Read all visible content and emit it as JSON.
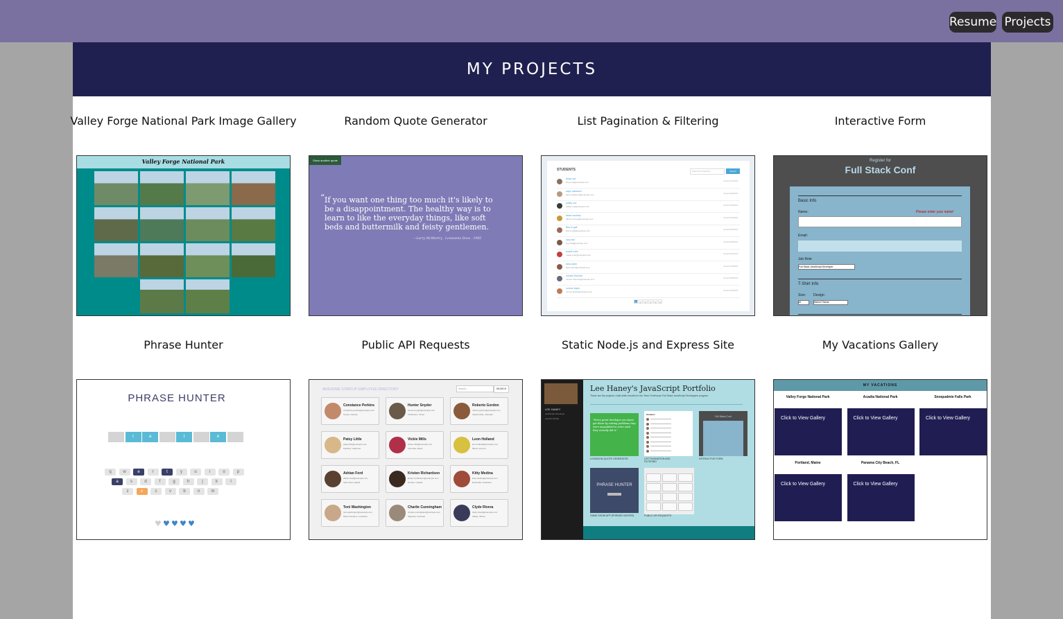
{
  "nav": {
    "resume": "Resume",
    "projects": "Projects"
  },
  "banner": {
    "title": "MY PROJECTS"
  },
  "projects": [
    {
      "title": "Valley Forge National Park Image Gallery"
    },
    {
      "title": "Random Quote Generator"
    },
    {
      "title": "List Pagination & Filtering"
    },
    {
      "title": "Interactive Form"
    },
    {
      "title": "Phrase Hunter"
    },
    {
      "title": "Public API Requests"
    },
    {
      "title": "Static Node.js and Express Site"
    },
    {
      "title": "My Vacations Gallery"
    }
  ],
  "thumb_gallery": {
    "heading": "Valley Forge National Park"
  },
  "thumb_quote": {
    "button": "Show another quote",
    "quote": "If you want one thing too much it's likely to be a disappointment. The healthy way is to learn to like the everyday things, like soft beds and buttermilk and feisty gentlemen.",
    "citation": "—Larry McMurtry , Lonesome Dove , 1985"
  },
  "thumb_students": {
    "heading": "STUDENTS",
    "search_placeholder": "Search for students...",
    "search_button": "Search",
    "rows": [
      {
        "name": "iboya vat",
        "email": "iboya.vat@example.com",
        "joined": "Joined 07/15/15"
      },
      {
        "name": "aapo niskanen",
        "email": "aapo.niskanen@example.com",
        "joined": "Joined 06/15/15"
      },
      {
        "name": "phillip cox",
        "email": "phillip.cox@example.com",
        "joined": "Joined 03/02/15"
      },
      {
        "name": "ethan moreau",
        "email": "ethan.moreau@example.com",
        "joined": "Joined 07/03/15"
      },
      {
        "name": "lilou le gall",
        "email": "lilou.le gall@example.com",
        "joined": "Joined 09/10/15"
      },
      {
        "name": "lucy hall",
        "email": "lucy.hall@example.com",
        "joined": "Joined 08/20/15"
      },
      {
        "name": "maele colin",
        "email": "maele.colin@example.com",
        "joined": "Joined 05/14/15"
      },
      {
        "name": "kara owen",
        "email": "kara.owen@example.com",
        "joined": "Joined 07/02/15"
      },
      {
        "name": "romain francois",
        "email": "romain.francois@example.com",
        "joined": "Joined 08/16/15"
      },
      {
        "name": "connor taylor",
        "email": "connor.taylor@example.com",
        "joined": "Joined 09/15/15"
      }
    ],
    "pages": [
      "1",
      "2",
      "3",
      "4",
      "5",
      "6"
    ]
  },
  "thumb_form": {
    "register": "Register for",
    "conf": "Full Stack Conf",
    "basic_info": "Basic Info",
    "name_label": "Name:",
    "name_error": "Please enter your name!",
    "email_label": "Email:",
    "job_label": "Job Role",
    "job_value": "Full Stack JavaScript Developer",
    "tshirt": "T-Shirt Info",
    "size_label": "Size:",
    "size_value": "M",
    "design_label": "Design:",
    "design_value": "Select Theme"
  },
  "thumb_phrase": {
    "title": "PHRASE HUNTER",
    "phrase_letters": [
      "",
      "t",
      "a",
      "",
      "t",
      "",
      "e",
      ""
    ],
    "phrase_shown": [
      false,
      true,
      true,
      false,
      true,
      false,
      true,
      false
    ],
    "rows": [
      [
        "q",
        "w",
        "e",
        "r",
        "t",
        "y",
        "u",
        "i",
        "o",
        "p"
      ],
      [
        "a",
        "s",
        "d",
        "f",
        "g",
        "h",
        "j",
        "k",
        "l"
      ],
      [
        "z",
        "x",
        "c",
        "v",
        "b",
        "n",
        "m"
      ]
    ],
    "used_dark": [
      "e",
      "t",
      "a"
    ],
    "used_orange": [
      "x"
    ],
    "hearts_total": 5,
    "hearts_lost": 1
  },
  "thumb_api": {
    "header": "AWESOME STARTUP EMPLOYEE DIRECTORY",
    "search_placeholder": "Search...",
    "search_button": "SEARCH",
    "cards": [
      {
        "name": "Constance Perkins",
        "email": "constance.perkins@example.com",
        "city": "Tempe, Kansas"
      },
      {
        "name": "Hunter Snyder",
        "email": "hunter.snyder@example.com",
        "city": "Charleston, Texas"
      },
      {
        "name": "Roberto Gordon",
        "email": "roberto.gordon@example.com",
        "city": "Jacksonville, Colorado"
      },
      {
        "name": "Patsy Little",
        "email": "patsy.little@example.com",
        "city": "Fairfield, California"
      },
      {
        "name": "Vickie Mills",
        "email": "vickie.mills@example.com",
        "city": "Knoxville, Maine"
      },
      {
        "name": "Leon Holland",
        "email": "leon.holland@example.com",
        "city": "Miami, Arizona"
      },
      {
        "name": "Adrian Ford",
        "email": "adrian.ford@example.com",
        "city": "Saint Paul, Hawaii"
      },
      {
        "name": "Kristen Richardson",
        "email": "kristen.richardson@example.com",
        "city": "Durham, Hawaii"
      },
      {
        "name": "Kitty Medina",
        "email": "kitty.medina@example.com",
        "city": "Evansville, Delaware"
      },
      {
        "name": "Toni Washington",
        "email": "toni.washington@example.com",
        "city": "Miami Gardens, Louisiana"
      },
      {
        "name": "Charlie Cunningham",
        "email": "charlie.cunningham@example.com",
        "city": "Saginaw, Colorado"
      },
      {
        "name": "Clyde Rivera",
        "email": "clyde.rivera@example.com",
        "city": "Vallejo, Illinois"
      }
    ]
  },
  "thumb_node": {
    "name": "LEE HANEY",
    "role": "JavaScript Developer",
    "learn_more": "LEARN MORE",
    "title": "Lee Haney's JavaScript Portfolio",
    "subtitle": "These are the projects I built while enrolled in the Team Treehouse Full Stack JavaScript Techdegree program.",
    "quote_card": "\"Every great developer you know got there by solving problems they were unqualified to solve until they actually did it.\"",
    "tile_students": "Students",
    "tile_conf": "Full Stack Conf",
    "tile_phrase": "PHRASE HUNTER",
    "captions": [
      "A RANDOM QUOTE GENERATOR",
      "LIST PAGINATION AND FILTERING",
      "INTERACTIVE FORM",
      "GAME SHOW APP (PHRASE HUNTER)",
      "PUBLIC API REQUESTS"
    ]
  },
  "thumb_vacations": {
    "heading": "MY VACATIONS",
    "parks": [
      "Valley Forge National Park",
      "Acadia National Park",
      "Snoqualmie Falls Park"
    ],
    "places": [
      "Portland, Maine",
      "Panama City Beach, FL"
    ],
    "tile_label": "Click to View Gallery"
  }
}
